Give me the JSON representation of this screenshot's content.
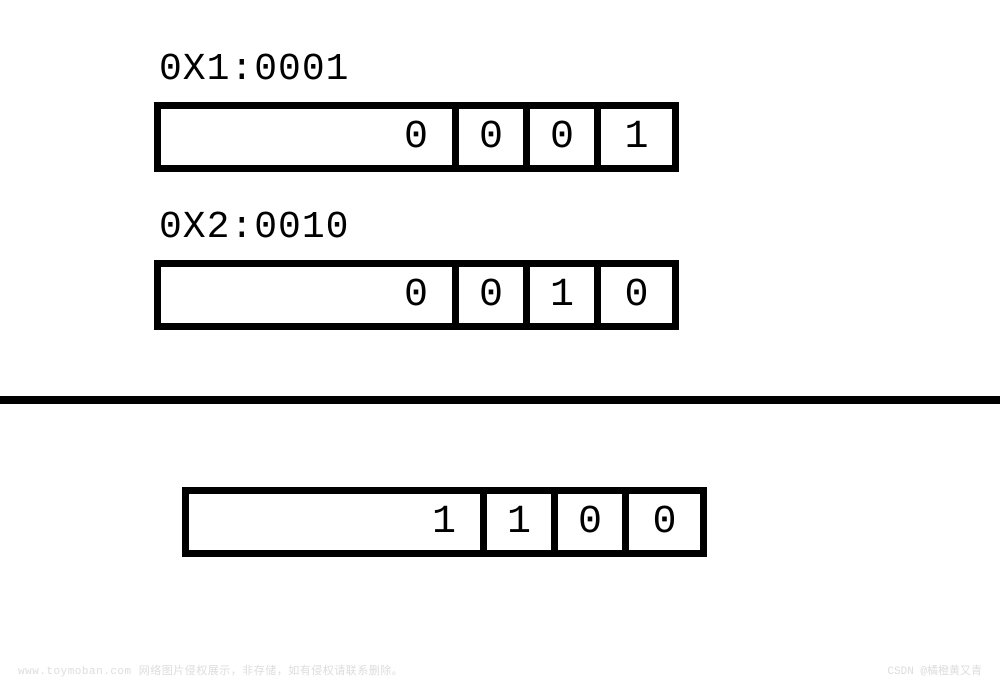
{
  "labels": {
    "row1": "0X1:0001",
    "row2": "0X2:0010"
  },
  "rows": {
    "r1": [
      "0",
      "0",
      "0",
      "1"
    ],
    "r2": [
      "0",
      "0",
      "1",
      "0"
    ],
    "r3": [
      "1",
      "1",
      "0",
      "0"
    ]
  },
  "watermark": {
    "left": "www.toymoban.com 网络图片侵权展示，非存储，如有侵权请联系删除。",
    "right": "CSDN @橘橙黄又青"
  }
}
